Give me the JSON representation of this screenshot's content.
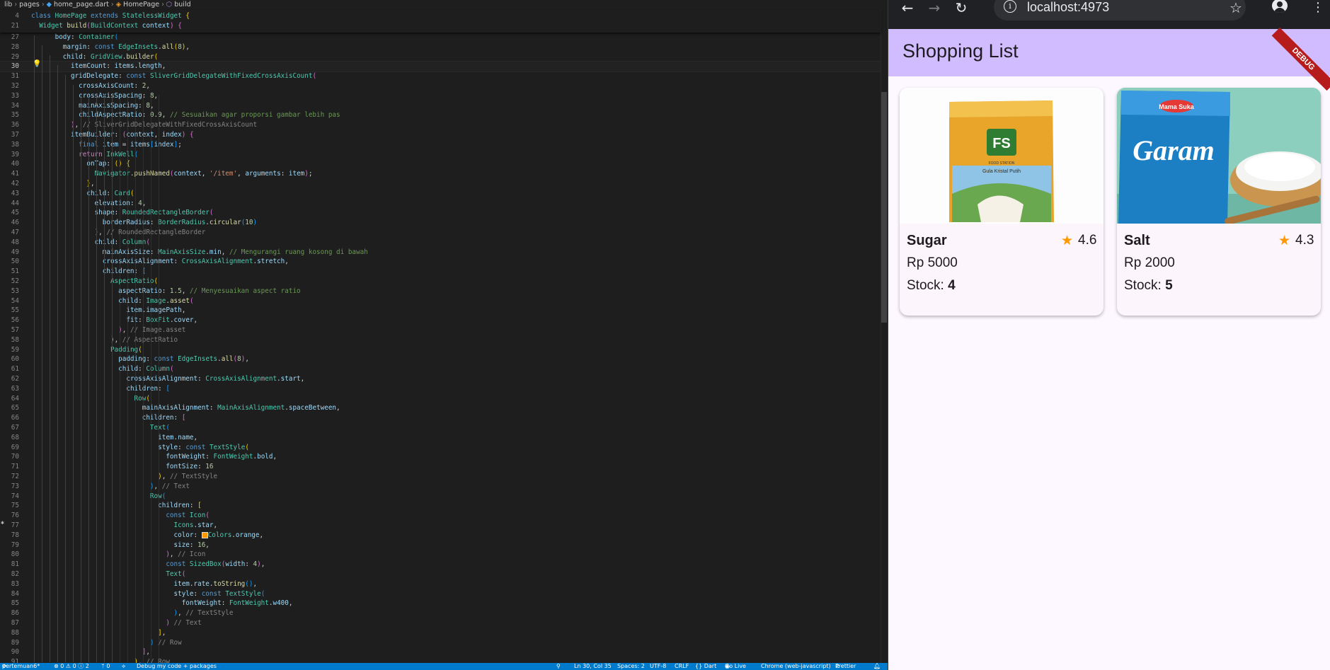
{
  "editor": {
    "breadcrumb": [
      "lib",
      "pages",
      "home_page.dart",
      "HomePage",
      "build"
    ],
    "sticky_lines": [
      {
        "num": "4",
        "html": "<span class=\"k\">class</span> <span class=\"c\">HomePage</span> <span class=\"k\">extends</span> <span class=\"c\">StatelessWidget</span> <span class=\"b1\">{</span>"
      },
      {
        "num": "21",
        "html": "  <span class=\"c\">Widget</span> <span class=\"f\">build</span><span class=\"b2\">(</span><span class=\"c\">BuildContext</span> <span class=\"p\">context</span><span class=\"b2\">)</span> <span class=\"b2\">{</span>"
      }
    ],
    "lines": [
      {
        "num": "27",
        "html": "      <span class=\"p\">body</span>: <span class=\"c\">Container</span><span class=\"b3\">(</span>"
      },
      {
        "num": "28",
        "html": "        <span class=\"p\">margin</span>: <span class=\"k\">const</span> <span class=\"c\">EdgeInsets</span>.<span class=\"f\">all</span><span class=\"b1\">(</span><span class=\"n\">8</span><span class=\"b1\">)</span>,"
      },
      {
        "num": "29",
        "html": "        <span class=\"p\">child</span>: <span class=\"c\">GridView</span>.<span class=\"f\">builder</span><span class=\"b1\">(</span>"
      },
      {
        "num": "30",
        "html": "          <span class=\"p\">itemCount</span>: <span class=\"p\">items</span>.<span class=\"p\">length</span>,",
        "active": true
      },
      {
        "num": "31",
        "html": "          <span class=\"p\">gridDelegate</span>: <span class=\"k\">const</span> <span class=\"c\">SliverGridDelegateWithFixedCrossAxisCount</span><span class=\"b2\">(</span>"
      },
      {
        "num": "32",
        "html": "            <span class=\"p\">crossAxisCount</span>: <span class=\"n\">2</span>,"
      },
      {
        "num": "33",
        "html": "            <span class=\"p\">crossAxisSpacing</span>: <span class=\"n\">8</span>,"
      },
      {
        "num": "34",
        "html": "            <span class=\"p\">mainAxisSpacing</span>: <span class=\"n\">8</span>,"
      },
      {
        "num": "35",
        "html": "            <span class=\"p\">childAspectRatio</span>: <span class=\"n\">0.9</span>, <span class=\"cm\">// Sesuaikan agar proporsi gambar lebih pas</span>"
      },
      {
        "num": "36",
        "html": "          <span class=\"b2\">)</span>, <span class=\"cl\">// SliverGridDelegateWithFixedCrossAxisCount</span>"
      },
      {
        "num": "37",
        "html": "          <span class=\"p\">itemBuilder</span>: <span class=\"b2\">(</span><span class=\"p\">context</span>, <span class=\"p\">index</span><span class=\"b2\">)</span> <span class=\"b2\">{</span>"
      },
      {
        "num": "38",
        "html": "            <span class=\"k\">final</span> <span class=\"p\">item</span> = <span class=\"p\">items</span><span class=\"b3\">[</span><span class=\"p\">index</span><span class=\"b3\">]</span>;"
      },
      {
        "num": "39",
        "html": "            <span class=\"ctl\">return</span> <span class=\"c\">InkWell</span><span class=\"b3\">(</span>"
      },
      {
        "num": "40",
        "html": "              <span class=\"p\">onTap</span>: <span class=\"b1\">()</span> <span class=\"b1\">{</span>"
      },
      {
        "num": "41",
        "html": "                <span class=\"c\">Navigator</span>.<span class=\"f\">pushNamed</span><span class=\"b2\">(</span><span class=\"p\">context</span>, <span class=\"s\">'/item'</span>, <span class=\"p\">arguments</span>: <span class=\"p\">item</span><span class=\"b2\">)</span>;"
      },
      {
        "num": "42",
        "html": "              <span class=\"b1\">}</span>,"
      },
      {
        "num": "43",
        "html": "              <span class=\"p\">child</span>: <span class=\"c\">Card</span><span class=\"b1\">(</span>"
      },
      {
        "num": "44",
        "html": "                <span class=\"p\">elevation</span>: <span class=\"n\">4</span>,"
      },
      {
        "num": "45",
        "html": "                <span class=\"p\">shape</span>: <span class=\"c\">RoundedRectangleBorder</span><span class=\"b2\">(</span>"
      },
      {
        "num": "46",
        "html": "                  <span class=\"p\">borderRadius</span>: <span class=\"c\">BorderRadius</span>.<span class=\"f\">circular</span><span class=\"b3\">(</span><span class=\"n\">10</span><span class=\"b3\">)</span>"
      },
      {
        "num": "47",
        "html": "                <span class=\"b2\">)</span>, <span class=\"cl\">// RoundedRectangleBorder</span>"
      },
      {
        "num": "48",
        "html": "                <span class=\"p\">child</span>: <span class=\"c\">Column</span><span class=\"b2\">(</span>"
      },
      {
        "num": "49",
        "html": "                  <span class=\"p\">mainAxisSize</span>: <span class=\"c\">MainAxisSize</span>.<span class=\"p\">min</span>, <span class=\"cm\">// Mengurangi ruang kosong di bawah</span>"
      },
      {
        "num": "50",
        "html": "                  <span class=\"p\">crossAxisAlignment</span>: <span class=\"c\">CrossAxisAlignment</span>.<span class=\"p\">stretch</span>,"
      },
      {
        "num": "51",
        "html": "                  <span class=\"p\">children</span>: <span class=\"b3\">[</span>"
      },
      {
        "num": "52",
        "html": "                    <span class=\"c\">AspectRatio</span><span class=\"b1\">(</span>"
      },
      {
        "num": "53",
        "html": "                      <span class=\"p\">aspectRatio</span>: <span class=\"n\">1.5</span>, <span class=\"cm\">// Menyesuaikan aspect ratio</span>"
      },
      {
        "num": "54",
        "html": "                      <span class=\"p\">child</span>: <span class=\"c\">Image</span>.<span class=\"f\">asset</span><span class=\"b2\">(</span>"
      },
      {
        "num": "55",
        "html": "                        <span class=\"p\">item</span>.<span class=\"p\">imagePath</span>,"
      },
      {
        "num": "56",
        "html": "                        <span class=\"p\">fit</span>: <span class=\"c\">BoxFit</span>.<span class=\"p\">cover</span>,"
      },
      {
        "num": "57",
        "html": "                      <span class=\"b2\">)</span>, <span class=\"cl\">// Image.asset</span>"
      },
      {
        "num": "58",
        "html": "                    <span class=\"b1\">)</span>, <span class=\"cl\">// AspectRatio</span>"
      },
      {
        "num": "59",
        "html": "                    <span class=\"c\">Padding</span><span class=\"b1\">(</span>"
      },
      {
        "num": "60",
        "html": "                      <span class=\"p\">padding</span>: <span class=\"k\">const</span> <span class=\"c\">EdgeInsets</span>.<span class=\"f\">all</span><span class=\"b2\">(</span><span class=\"n\">8</span><span class=\"b2\">)</span>,"
      },
      {
        "num": "61",
        "html": "                      <span class=\"p\">child</span>: <span class=\"c\">Column</span><span class=\"b2\">(</span>"
      },
      {
        "num": "62",
        "html": "                        <span class=\"p\">crossAxisAlignment</span>: <span class=\"c\">CrossAxisAlignment</span>.<span class=\"p\">start</span>,"
      },
      {
        "num": "63",
        "html": "                        <span class=\"p\">children</span>: <span class=\"b3\">[</span>"
      },
      {
        "num": "64",
        "html": "                          <span class=\"c\">Row</span><span class=\"b1\">(</span>"
      },
      {
        "num": "65",
        "html": "                            <span class=\"p\">mainAxisAlignment</span>: <span class=\"c\">MainAxisAlignment</span>.<span class=\"p\">spaceBetween</span>,"
      },
      {
        "num": "66",
        "html": "                            <span class=\"p\">children</span>: <span class=\"b2\">[</span>"
      },
      {
        "num": "67",
        "html": "                              <span class=\"c\">Text</span><span class=\"b3\">(</span>"
      },
      {
        "num": "68",
        "html": "                                <span class=\"p\">item</span>.<span class=\"p\">name</span>,"
      },
      {
        "num": "69",
        "html": "                                <span class=\"p\">style</span>: <span class=\"k\">const</span> <span class=\"c\">TextStyle</span><span class=\"b1\">(</span>"
      },
      {
        "num": "70",
        "html": "                                  <span class=\"p\">fontWeight</span>: <span class=\"c\">FontWeight</span>.<span class=\"p\">bold</span>,"
      },
      {
        "num": "71",
        "html": "                                  <span class=\"p\">fontSize</span>: <span class=\"n\">16</span>"
      },
      {
        "num": "72",
        "html": "                                <span class=\"b1\">)</span>, <span class=\"cl\">// TextStyle</span>"
      },
      {
        "num": "73",
        "html": "                              <span class=\"b3\">)</span>, <span class=\"cl\">// Text</span>"
      },
      {
        "num": "74",
        "html": "                              <span class=\"c\">Row</span><span class=\"b3\">(</span>"
      },
      {
        "num": "75",
        "html": "                                <span class=\"p\">children</span>: <span class=\"b1\">[</span>"
      },
      {
        "num": "76",
        "html": "                                  <span class=\"k\">const</span> <span class=\"c\">Icon</span><span class=\"b2\">(</span>"
      },
      {
        "num": "77",
        "html": "                                    <span class=\"c\">Icons</span>.<span class=\"p\">star</span>,"
      },
      {
        "num": "78",
        "html": "                                    <span class=\"p\">color</span>: <span style=\"display:inline-block;width:7px;height:7px;background:#ff9800;border:1px solid #ddd;vertical-align:middle\"></span><span class=\"c\">Colors</span>.<span class=\"p\">orange</span>,"
      },
      {
        "num": "79",
        "html": "                                    <span class=\"p\">size</span>: <span class=\"n\">16</span>,"
      },
      {
        "num": "80",
        "html": "                                  <span class=\"b2\">)</span>, <span class=\"cl\">// Icon</span>"
      },
      {
        "num": "81",
        "html": "                                  <span class=\"k\">const</span> <span class=\"c\">SizedBox</span><span class=\"b2\">(</span><span class=\"p\">width</span>: <span class=\"n\">4</span><span class=\"b2\">)</span>,"
      },
      {
        "num": "82",
        "html": "                                  <span class=\"c\">Text</span><span class=\"b2\">(</span>"
      },
      {
        "num": "83",
        "html": "                                    <span class=\"p\">item</span>.<span class=\"p\">rate</span>.<span class=\"f\">toString</span><span class=\"b3\">()</span>,"
      },
      {
        "num": "84",
        "html": "                                    <span class=\"p\">style</span>: <span class=\"k\">const</span> <span class=\"c\">TextStyle</span><span class=\"b3\">(</span>"
      },
      {
        "num": "85",
        "html": "                                      <span class=\"p\">fontWeight</span>: <span class=\"c\">FontWeight</span>.<span class=\"p\">w400</span>,"
      },
      {
        "num": "86",
        "html": "                                    <span class=\"b3\">)</span>, <span class=\"cl\">// TextStyle</span>"
      },
      {
        "num": "87",
        "html": "                                  <span class=\"b2\">)</span> <span class=\"cl\">// Text</span>"
      },
      {
        "num": "88",
        "html": "                                <span class=\"b1\">]</span>,"
      },
      {
        "num": "89",
        "html": "                              <span class=\"b3\">)</span> <span class=\"cl\">// Row</span>"
      },
      {
        "num": "90",
        "html": "                            <span class=\"b2\">]</span>,"
      },
      {
        "num": "91",
        "html": "                          <span class=\"b1\">)</span>, <span class=\"cl\">// Row</span>"
      }
    ]
  },
  "statusbar": {
    "branch": "pertemuan6*",
    "problems": "⊗ 0 ⚠ 0 ⓘ 2",
    "ports": "ᛘ 0",
    "debug": "Debug my code + packages",
    "position": "Ln 30, Col 35",
    "spaces": "Spaces: 2",
    "encoding": "UTF-8",
    "eol": "CRLF",
    "language": "{} Dart",
    "golive": "Go Live",
    "device": "Chrome (web-javascript)",
    "formatter": "Prettier"
  },
  "browser": {
    "url": "localhost:4973",
    "app_title": "Shopping List",
    "debug_banner": "DEBUG",
    "items": [
      {
        "name": "Sugar",
        "rate": "4.6",
        "price": "Rp 5000",
        "stock_label": "Stock: ",
        "stock": "4",
        "image": "sugar-pack"
      },
      {
        "name": "Salt",
        "rate": "4.3",
        "price": "Rp 2000",
        "stock_label": "Stock: ",
        "stock": "5",
        "image": "salt-pack"
      }
    ],
    "sugar_pack_text": {
      "brand": "FS",
      "sub": "FOOD STATION",
      "line": "Gula Kristal Putih"
    },
    "salt_pack_text": {
      "brand": "Garam",
      "maker": "Mama Suka"
    }
  },
  "colors": {
    "appbar": "#d0bcff",
    "debug": "#b71c1c",
    "star": "#ff9800",
    "statusbar": "#007acc"
  }
}
